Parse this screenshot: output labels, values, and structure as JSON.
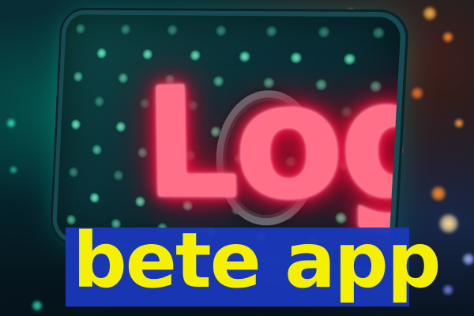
{
  "sign": {
    "text": "Login",
    "neon_color": "#ff2e5c",
    "backlight_color": "#44e8b0"
  },
  "caption": {
    "text": "bete app",
    "text_color": "#f4f000",
    "box_color": "#1a38b8"
  }
}
